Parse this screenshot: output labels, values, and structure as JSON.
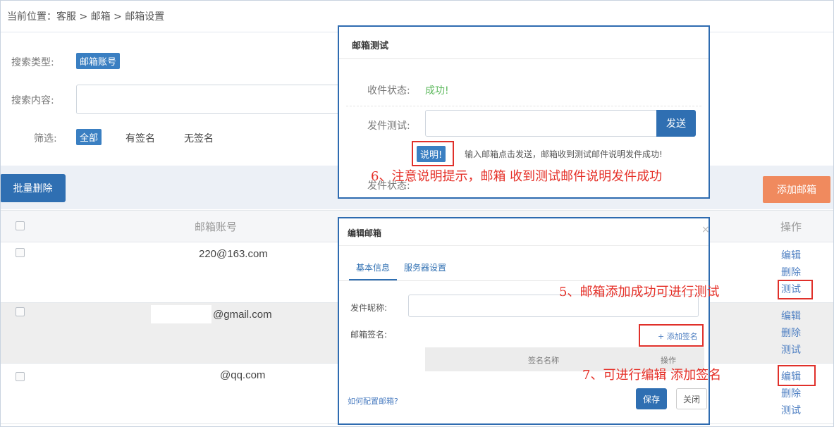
{
  "breadcrumb": "当前位置：客服 > 邮箱 > 邮箱设置",
  "search": {
    "type_label": "搜索类型:",
    "type_tag": "邮箱账号",
    "content_label": "搜索内容:",
    "filter_label": "筛选:",
    "filters": [
      "全部",
      "有签名",
      "无签名"
    ]
  },
  "toolbar": {
    "batch_delete": "批量删除",
    "add_email": "添加邮箱"
  },
  "table": {
    "col_account": "邮箱账号",
    "col_actions": "操作",
    "rows": [
      {
        "email": "220@163.com",
        "actions": [
          "编辑",
          "删除",
          "测试"
        ]
      },
      {
        "email": "@gmail.com",
        "actions": [
          "编辑",
          "删除",
          "测试"
        ]
      },
      {
        "email": "@qq.com",
        "actions": [
          "编辑",
          "删除",
          "测试"
        ]
      }
    ]
  },
  "test_modal": {
    "title": "邮箱测试",
    "receive_label": "收件状态:",
    "receive_value": "成功!",
    "send_label": "发件测试:",
    "send_button": "发送",
    "help_badge": "说明!",
    "help_text": "输入邮箱点击发送，邮箱收到测试邮件说明发件成功!",
    "send_status_label": "发件状态:"
  },
  "edit_modal": {
    "title": "编辑邮箱",
    "close": "×",
    "tabs": [
      "基本信息",
      "服务器设置"
    ],
    "nickname_label": "发件昵称:",
    "signature_label": "邮箱签名:",
    "add_signature": "+ 添加签名",
    "sig_col_name": "签名名称",
    "sig_col_action": "操作",
    "help_link": "如何配置邮箱?",
    "save": "保存",
    "close_button": "关闭"
  },
  "annotations": {
    "a5": "5、邮箱添加成功可进行测试",
    "a6": "6、注意说明提示，邮箱 收到测试邮件说明发件成功",
    "a7": "7、可进行编辑 添加签名"
  },
  "colors": {
    "accent": "#2f6fb2",
    "orange": "#f08a5e",
    "success": "#5cb85c",
    "annotation": "#e53028"
  }
}
